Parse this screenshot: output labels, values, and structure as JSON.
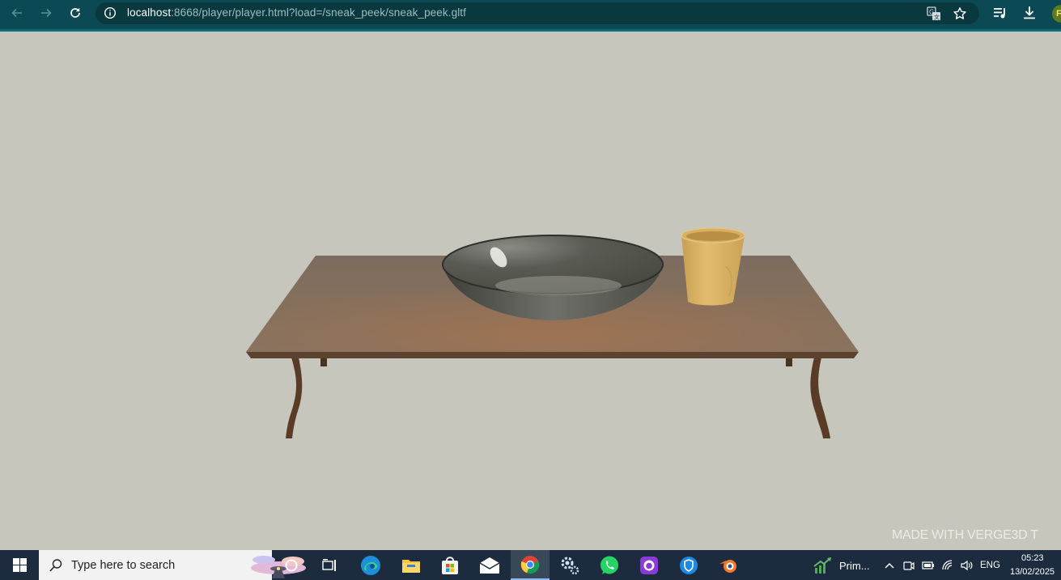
{
  "browser": {
    "url_host": "localhost",
    "url_rest": ":8668/player/player.html?load=/sneak_peek/sneak_peek.gltf",
    "profile_initial": "F",
    "icons": [
      "back-icon",
      "forward-icon",
      "reload-icon",
      "site-info-icon",
      "translate-icon",
      "bookmark-star-icon",
      "media-control-icon",
      "download-icon"
    ]
  },
  "viewport": {
    "background": "#c6c6bd",
    "watermark": "MADE WITH VERGE3D T",
    "scene_objects": [
      "table",
      "bowl",
      "cup"
    ]
  },
  "taskbar": {
    "search_placeholder": "Type here to search",
    "apps": [
      "task-view",
      "cortana",
      "edge",
      "file-explorer",
      "microsoft-store",
      "mail",
      "chrome",
      "settings",
      "whatsapp",
      "github-desktop",
      "app",
      "blender"
    ],
    "tray_app_label": "Prim...",
    "language": "ENG",
    "time": "05:23",
    "date": "13/02/2025"
  }
}
